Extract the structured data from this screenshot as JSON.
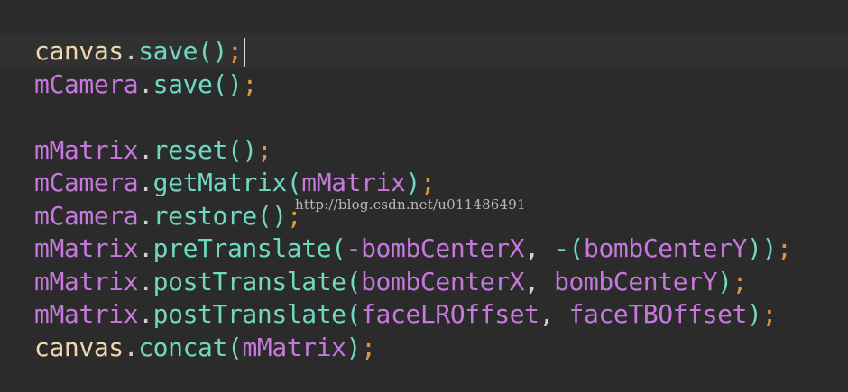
{
  "editor": {
    "background": "#2b2b2b",
    "current_line_bg": "#313131",
    "colors": {
      "object": "#f0d7ae",
      "variable": "#c678dd",
      "method": "#6fd9c0",
      "punctuation_semicolon": "#e0933f"
    },
    "lines": [
      {
        "tokens": [
          "canvas",
          ".",
          "save",
          "()",
          ";"
        ]
      },
      {
        "tokens": [
          "mCamera",
          ".",
          "save",
          "()",
          ";"
        ]
      },
      {
        "tokens": []
      },
      {
        "tokens": [
          "mMatrix",
          ".",
          "reset",
          "()",
          ";"
        ]
      },
      {
        "tokens": [
          "mCamera",
          ".",
          "getMatrix",
          "(",
          "mMatrix",
          ")",
          ";"
        ]
      },
      {
        "tokens": [
          "mCamera",
          ".",
          "restore",
          "()",
          ";"
        ]
      },
      {
        "tokens": [
          "mMatrix",
          ".",
          "preTranslate",
          "(",
          "-bombCenterX",
          ", ",
          "-(",
          "bombCenterY",
          "))",
          ";"
        ]
      },
      {
        "tokens": [
          "mMatrix",
          ".",
          "postTranslate",
          "(",
          "bombCenterX",
          ", ",
          "bombCenterY",
          ")",
          ";"
        ]
      },
      {
        "tokens": [
          "mMatrix",
          ".",
          "postTranslate",
          "(",
          "faceLROffset",
          ", ",
          "faceTBOffset",
          ")",
          ";"
        ]
      },
      {
        "tokens": [
          "canvas",
          ".",
          "concat",
          "(",
          "mMatrix",
          ")",
          ";"
        ]
      }
    ]
  },
  "watermark": "http://blog.csdn.net/u011486491"
}
